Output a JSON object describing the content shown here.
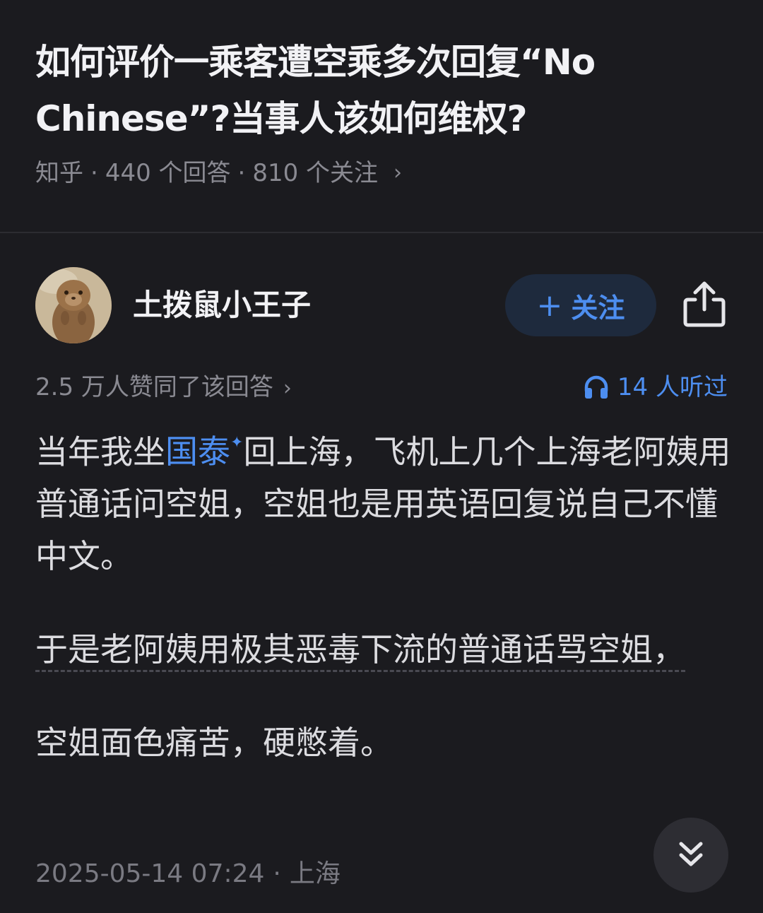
{
  "question": {
    "title": "如何评价一乘客遭空乘多次回复“No Chinese”?当事人该如何维权?",
    "source": "知乎",
    "answers": "440 个回答",
    "followers": "810 个关注"
  },
  "author": {
    "name": "土拨鼠小王子",
    "follow_label": "关注"
  },
  "stats": {
    "agree": "2.5 万人赞同了该回答",
    "listened": "14 人听过"
  },
  "content": {
    "p1_before": "当年我坐",
    "p1_link": "国泰",
    "p1_after": "回上海，飞机上几个上海老阿姨用普通话问空姐，空姐也是用英语回复说自己不懂中文。",
    "p2": "于是老阿姨用极其恶毒下流的普通话骂空姐，",
    "p3": "空姐面色痛苦，硬憋着。"
  },
  "footer": {
    "date": "2025-05-14 07:24",
    "location": "上海"
  },
  "colors": {
    "background": "#1b1b1f",
    "accent": "#4d8ef0",
    "follow_bg": "#1e2a3d",
    "muted_text": "#8a8a92"
  },
  "icons": {
    "share": "share-icon",
    "headphones": "headphones-icon",
    "scroll_down": "double-chevron-down-icon"
  }
}
